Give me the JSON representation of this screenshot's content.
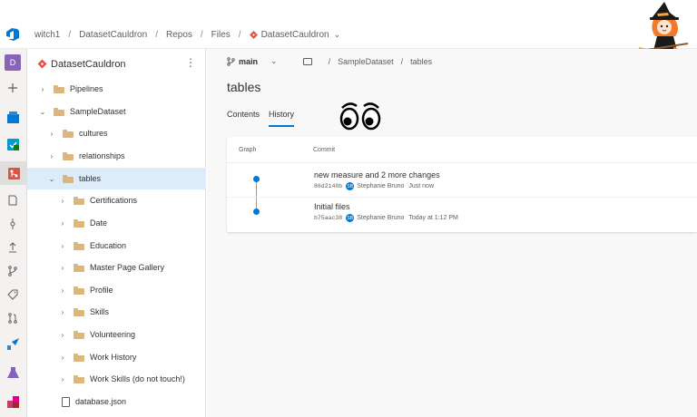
{
  "breadcrumb": {
    "org": "witch1",
    "project": "DatasetCauldron",
    "section1": "Repos",
    "section2": "Files",
    "repo": "DatasetCauldron"
  },
  "rail": {
    "project_initial": "D"
  },
  "tree": {
    "repo_title": "DatasetCauldron",
    "more": "⋮",
    "nodes": [
      {
        "label": "Pipelines",
        "chev": "›"
      },
      {
        "label": "SampleDataset",
        "chev": "⌄"
      },
      {
        "label": "cultures",
        "chev": "›"
      },
      {
        "label": "relationships",
        "chev": "›"
      },
      {
        "label": "tables",
        "chev": "⌄"
      },
      {
        "label": "Certifications",
        "chev": "›"
      },
      {
        "label": "Date",
        "chev": "›"
      },
      {
        "label": "Education",
        "chev": "›"
      },
      {
        "label": "Master Page Gallery",
        "chev": "›"
      },
      {
        "label": "Profile",
        "chev": "›"
      },
      {
        "label": "Skills",
        "chev": "›"
      },
      {
        "label": "Volunteering",
        "chev": "›"
      },
      {
        "label": "Work History",
        "chev": "›"
      },
      {
        "label": "Work Skills (do not touch!)",
        "chev": "›"
      },
      {
        "label": "database.json"
      }
    ]
  },
  "main": {
    "branch": "main",
    "path": [
      "SampleDataset",
      "tables"
    ],
    "title": "tables",
    "tabs": [
      "Contents",
      "History"
    ],
    "active_tab": "History",
    "columns": {
      "graph": "Graph",
      "commit": "Commit"
    },
    "commits": [
      {
        "message": "new measure and 2 more changes",
        "hash": "86d2140b",
        "author": "Stephanie Bruno",
        "when": "Just now"
      },
      {
        "message": "Initial files",
        "hash": "b75aac38",
        "author": "Stephanie Bruno",
        "when": "Today at 1:12 PM"
      }
    ]
  },
  "colors": {
    "accent": "#0078d4",
    "selected_row": "#deecf9",
    "folder": "#dcb67a",
    "repo_red": "#e05243"
  }
}
